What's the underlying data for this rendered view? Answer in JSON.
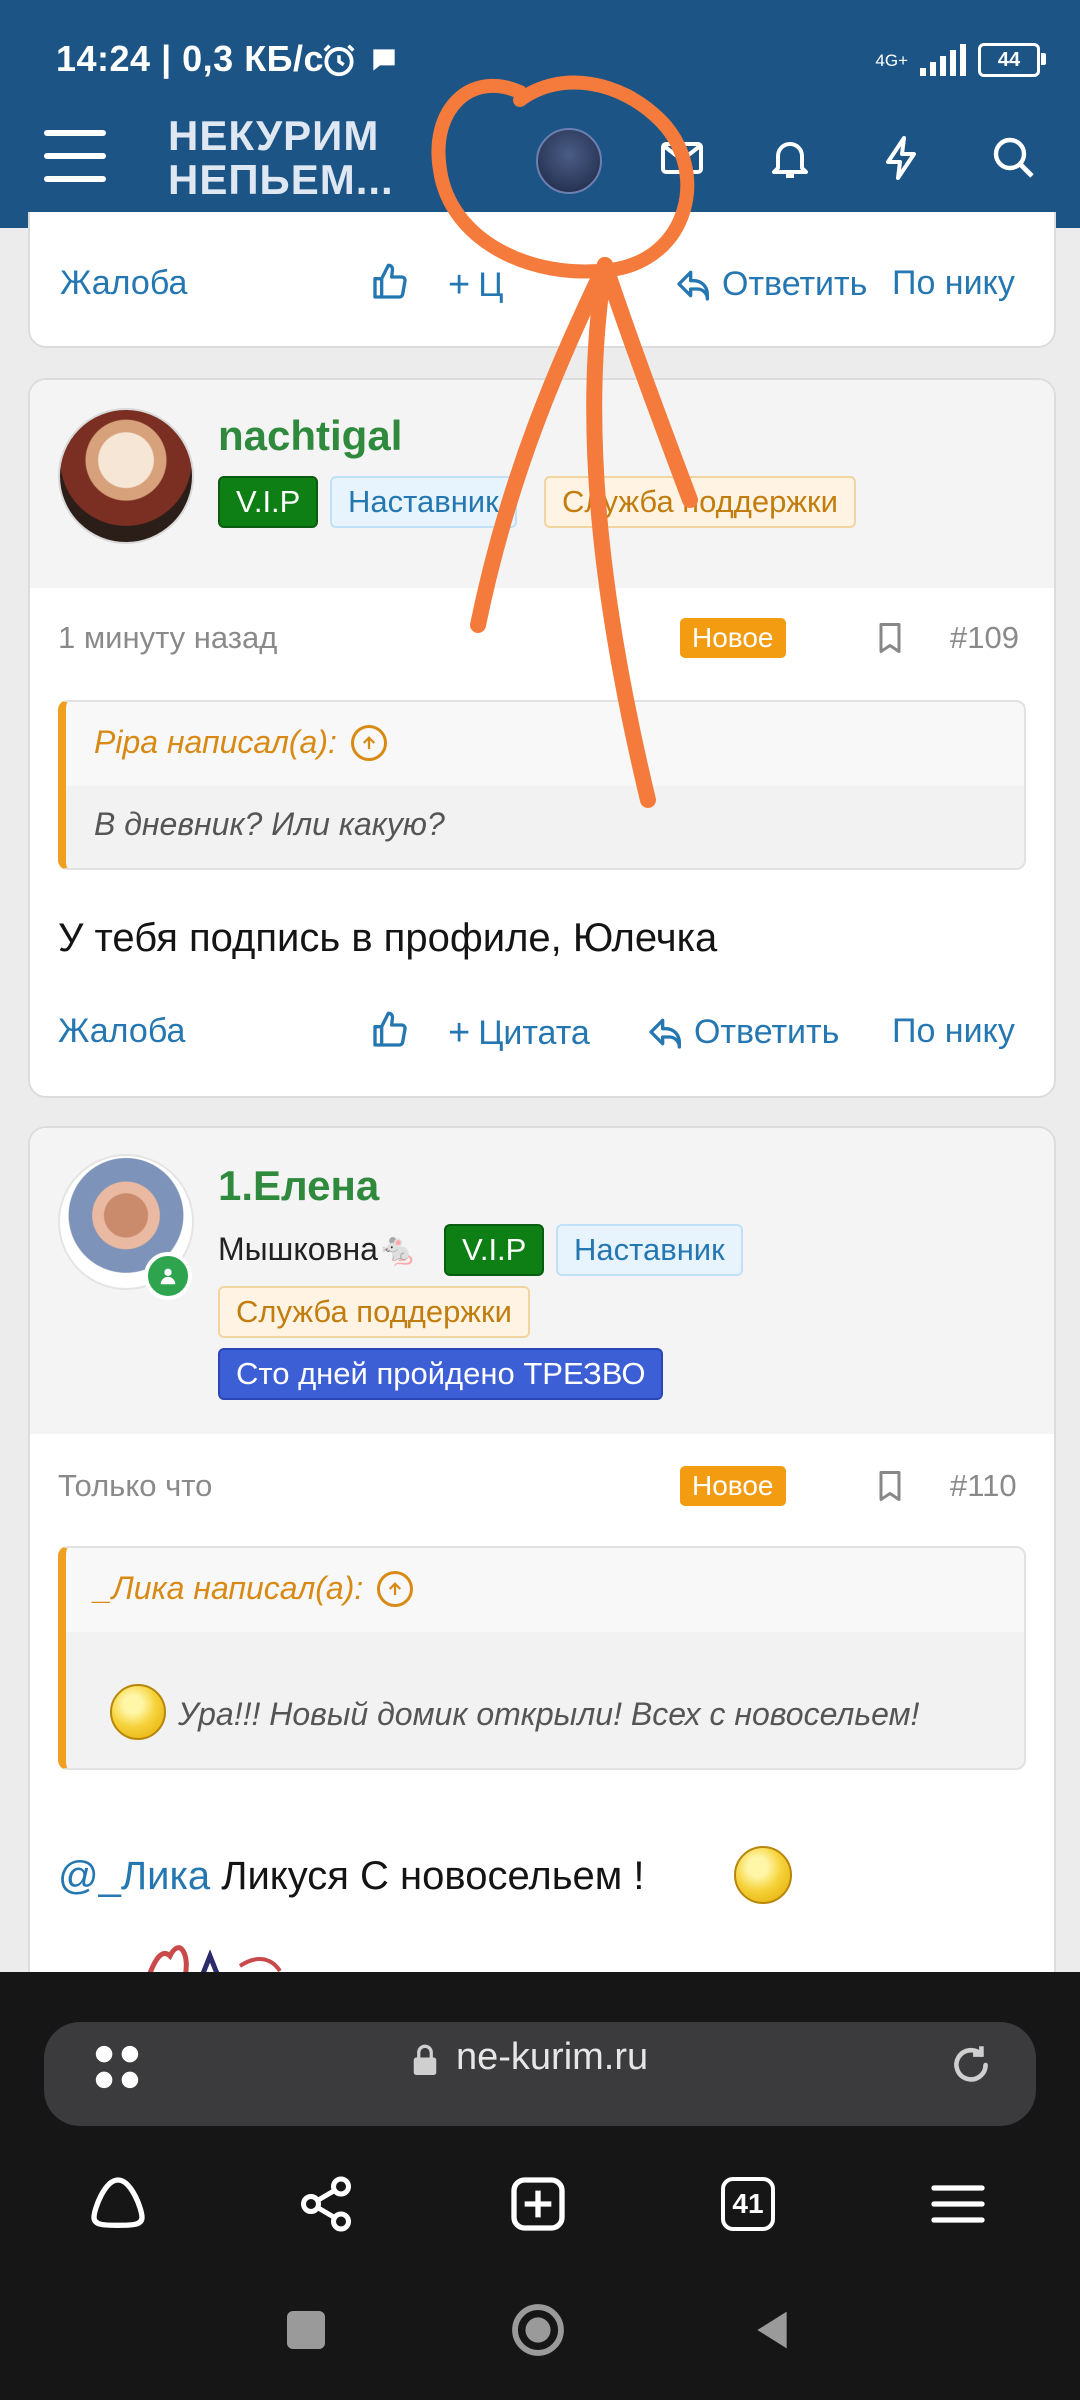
{
  "status_bar": {
    "time": "14:24 | 0,3 КБ/с",
    "network": "4G+",
    "battery": "44"
  },
  "header": {
    "logo_line1": "НЕКУРИМ",
    "logo_line2": "НЕПЬЕМ..."
  },
  "prev_post": {
    "actions": {
      "report": "Жалоба",
      "reply": "Ответить",
      "by_nick": "По нику"
    }
  },
  "post109": {
    "username": "nachtigal",
    "badges": [
      "V.I.P",
      "Наставник",
      "Служба поддержки"
    ],
    "time": "1 минуту назад",
    "new_badge": "Новое",
    "number": "#109",
    "quote_author": "Pipa написал(а):",
    "quote_text": "В дневник? Или какую?",
    "body": "У тебя подпись в профиле, Юлечка",
    "actions": {
      "report": "Жалоба",
      "quote": "Цитата",
      "reply": "Ответить",
      "by_nick": "По нику"
    }
  },
  "post110": {
    "username": "1.Елена",
    "subtitle": "Мышковна🐁",
    "badges": [
      "V.I.P",
      "Наставник",
      "Служба поддержки",
      "Сто дней пройдено ТРЕЗВО"
    ],
    "time": "Только что",
    "new_badge": "Новое",
    "number": "#110",
    "quote_author": "_Лика написал(а):",
    "quote_text": "Ура!!! Новый домик открыли! Всех с новосельем!",
    "mention": "@_Лика",
    "body": " Ликуся С новосельем !"
  },
  "browser": {
    "url": "ne-kurim.ru",
    "tabs_count": "41"
  },
  "colors": {
    "header_bg": "#1c5585",
    "accent": "#2577b1",
    "username": "#2f8a3e",
    "annotation": "#f47b3c"
  }
}
